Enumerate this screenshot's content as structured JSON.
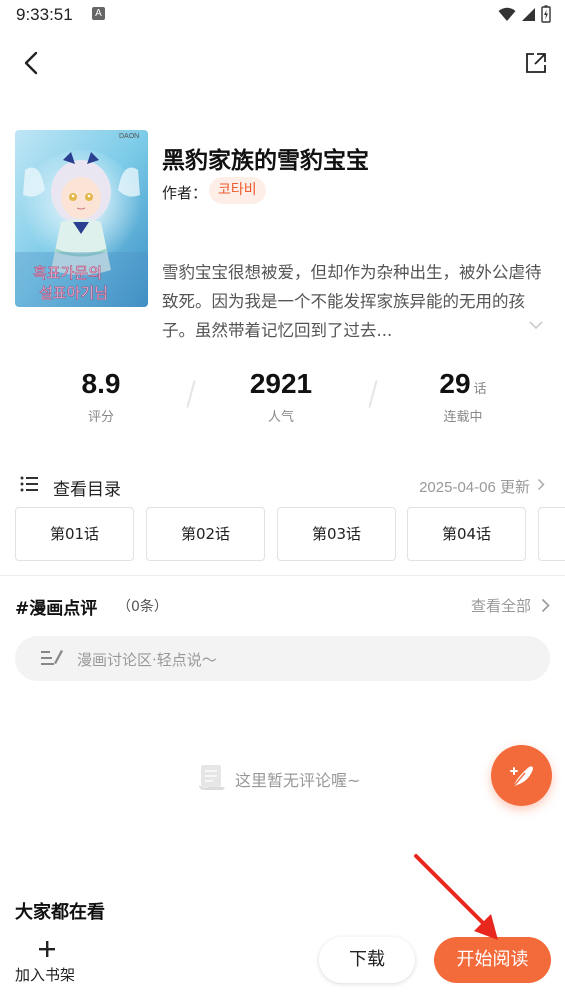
{
  "status_bar": {
    "time": "9:33:51",
    "notification_icon": "A"
  },
  "nav": {
    "back_icon": "chevron-left-icon",
    "share_icon": "share-icon"
  },
  "manga": {
    "title": "黑豹家族的雪豹宝宝",
    "author_label": "作者：",
    "author": "코타비",
    "synopsis": "雪豹宝宝很想被爱，但却作为杂种出生，被外公虐待致死。因为我是一个不能发挥家族异能的无用的孩子。虽然带着记忆回到了过去..."
  },
  "stats": {
    "rating": {
      "value": "8.9",
      "label": "评分"
    },
    "popularity": {
      "value": "2921",
      "label": "人气"
    },
    "chapters": {
      "value": "29",
      "unit": "话",
      "label": "连载中"
    }
  },
  "toc": {
    "label": "查看目录",
    "update_text": "2025-04-06 更新"
  },
  "chapters": [
    "第01话",
    "第02话",
    "第03话",
    "第04话"
  ],
  "reviews": {
    "title": "#漫画点评",
    "count": "（0条）",
    "view_all": "查看全部",
    "input_placeholder": "漫画讨论区·轻点说～",
    "empty_text": "这里暂无评论喔~"
  },
  "popular": {
    "title": "大家都在看"
  },
  "bottom_bar": {
    "shelf_label": "加入书架",
    "download_label": "下载",
    "read_label": "开始阅读"
  },
  "colors": {
    "accent": "#f36a3b",
    "author_tag_bg": "#fdeee8",
    "arrow": "#e8281e"
  }
}
